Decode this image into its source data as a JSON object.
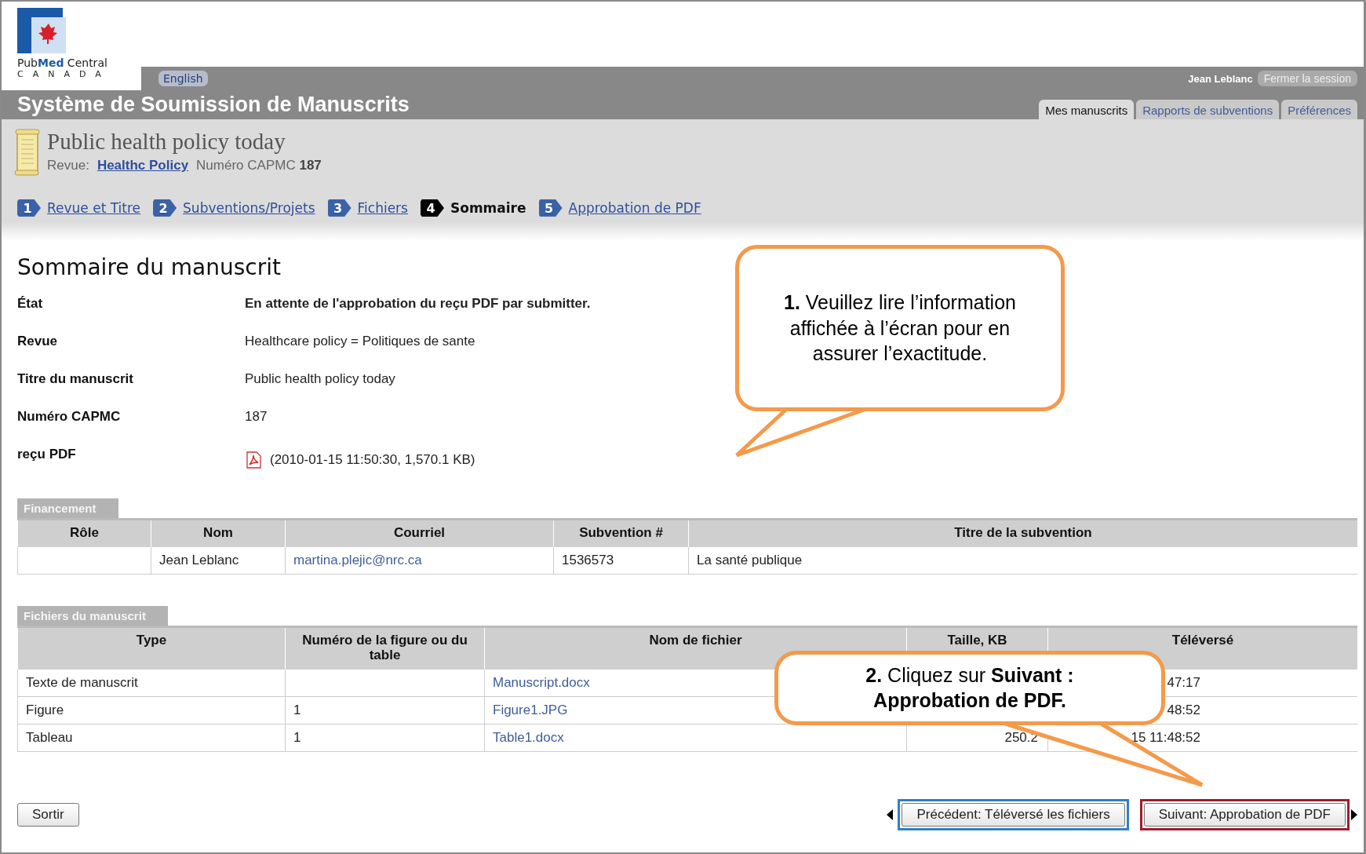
{
  "logo": {
    "line_1": "Pub**Med** Central",
    "line_2": "CANADA"
  },
  "language_link": "English",
  "app_title": "Système de Soumission de Manuscrits",
  "user": {
    "name": "Jean Leblanc",
    "logout": "Fermer la session"
  },
  "tabs": [
    {
      "label": "Mes manuscrits",
      "selected": true
    },
    {
      "label": "Rapports de subventions",
      "selected": false
    },
    {
      "label": "Préférences",
      "selected": false
    }
  ],
  "manuscript": {
    "title": "Public health policy today",
    "journal_label": "Revue:",
    "journal": "Healthc Policy",
    "number_label": "Numéro CAPMC",
    "number": "187"
  },
  "steps": [
    {
      "number": "1",
      "label": "Revue et Titre",
      "selected": false
    },
    {
      "number": "2",
      "label": "Subventions/Projets",
      "selected": false
    },
    {
      "number": "3",
      "label": "Fichiers",
      "selected": false
    },
    {
      "number": "4",
      "label": "Sommaire",
      "selected": true
    },
    {
      "number": "5",
      "label": "Approbation de PDF",
      "selected": false
    }
  ],
  "summary": {
    "heading": "Sommaire du manuscrit",
    "fields": [
      {
        "label": "État",
        "value": "En attente de l'approbation du reçu PDF par submitter.",
        "kind": "bold"
      },
      {
        "label": "Revue",
        "value": "Healthcare policy = Politiques de sante",
        "kind": "text"
      },
      {
        "label": "Titre du manuscrit",
        "value": "Public health policy today",
        "kind": "text"
      },
      {
        "label": "Numéro CAPMC",
        "value": "187",
        "kind": "text"
      },
      {
        "label": "reçu PDF",
        "value": "(2010-01-15 11:50:30, 1,570.1 KB)",
        "kind": "pdf"
      }
    ]
  },
  "funding": {
    "tab": "Financement",
    "columns": [
      "Rôle",
      "Nom",
      "Courriel",
      "Subvention #",
      "Titre de la subvention"
    ],
    "rows": [
      {
        "role": "",
        "name": "Jean Leblanc",
        "email": "martina.plejic@nrc.ca",
        "grant": "1536573",
        "grant_title": "La santé publique"
      }
    ]
  },
  "files": {
    "tab": "Fichiers du manuscrit",
    "columns": [
      "Type",
      "Numéro de la figure ou du table",
      "Nom de fichier",
      "Taille, KB",
      "Téléversé"
    ],
    "rows": [
      {
        "type": "Texte de manuscrit",
        "number": "",
        "file": "Manuscript.docx",
        "size": "",
        "uploaded": "47:17"
      },
      {
        "type": "Figure",
        "number": "1",
        "file": "Figure1.JPG",
        "size": "",
        "uploaded": "48:52"
      },
      {
        "type": "Tableau",
        "number": "1",
        "file": "Table1.docx",
        "size": "250.2",
        "uploaded": "15 11:48:52"
      }
    ]
  },
  "buttons": {
    "exit": "Sortir",
    "previous": {
      "label": "Précédent: Téléversé les fichiers",
      "color": "#2f7fc4"
    },
    "next": {
      "label": "Suivant: Approbation de PDF",
      "color": "#a01c2c"
    }
  },
  "callouts": [
    {
      "text": "**1.** Veuillez lire l’information affichée à l’écran pour en assurer l’exactitude."
    },
    {
      "text": "**2.** Cliquez sur **Suivant : Approbation de PDF.**"
    }
  ]
}
